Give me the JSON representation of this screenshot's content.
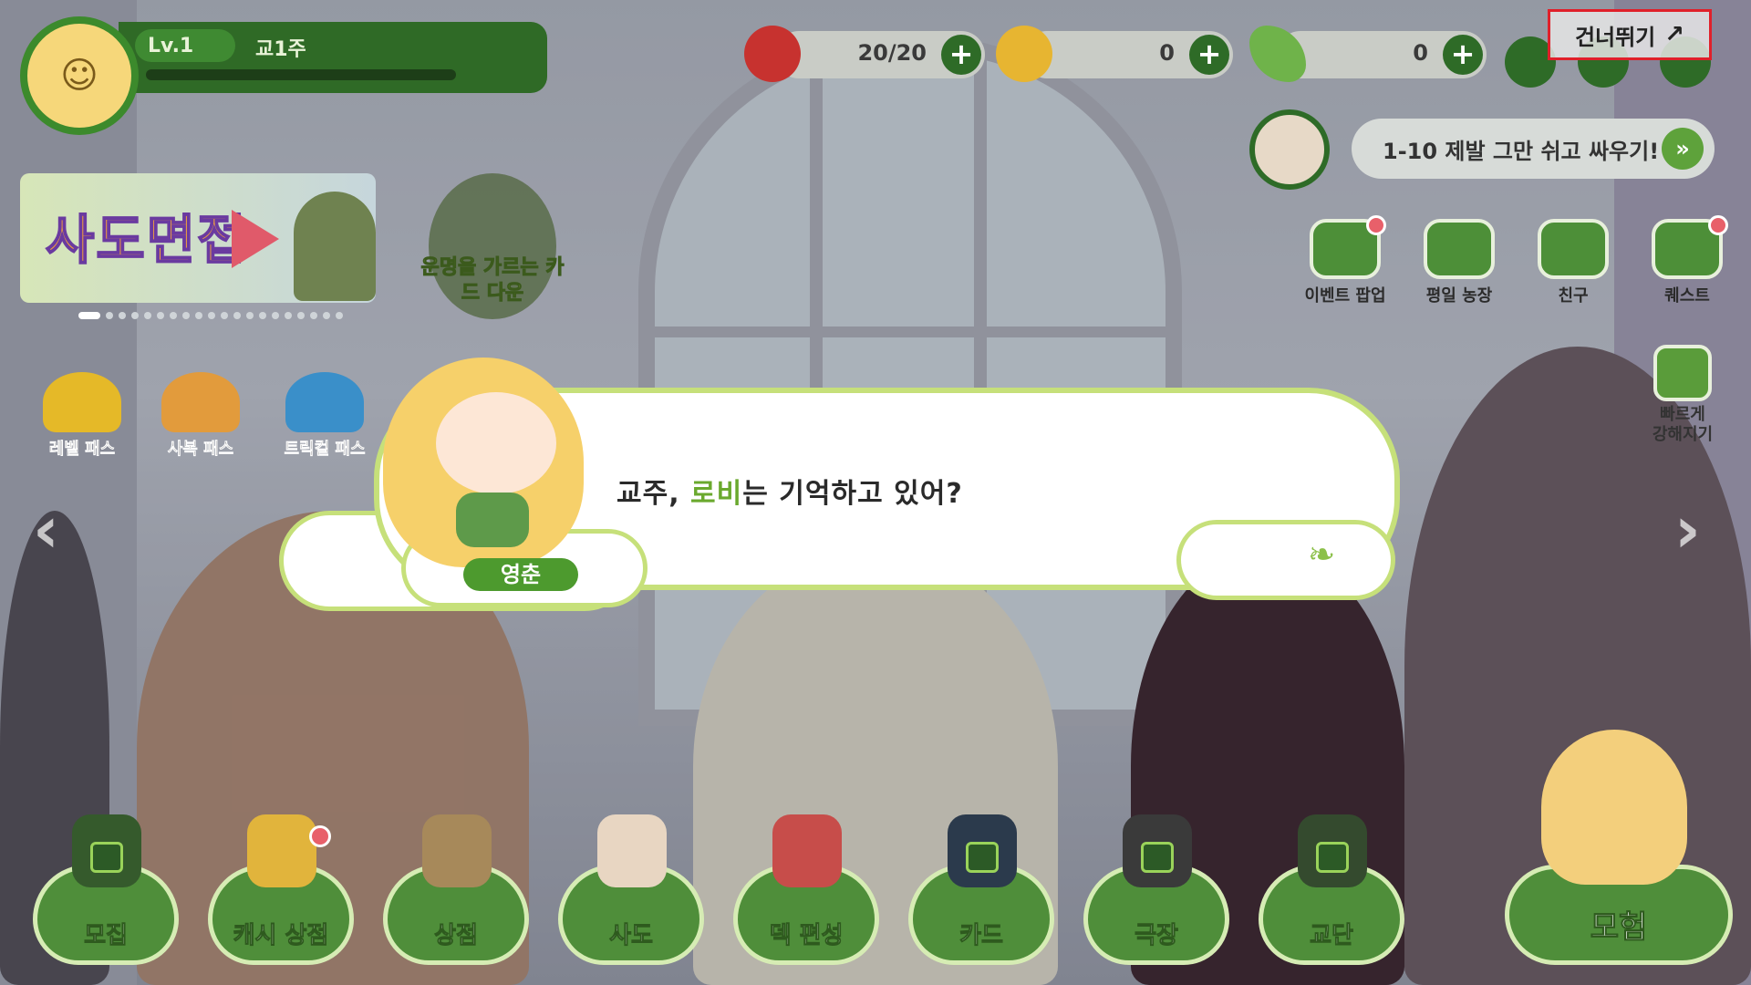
{
  "profile": {
    "level": "Lv.1",
    "name": "교1주",
    "exp_fraction": 0.0
  },
  "currencies": [
    {
      "id": "stamina",
      "value": "20/20",
      "icon": "red-orb-icon",
      "color": "#c7322f"
    },
    {
      "id": "gold",
      "value": "0",
      "icon": "gold-leaf-coin-icon",
      "color": "#e7b531"
    },
    {
      "id": "gem",
      "value": "0",
      "icon": "butterfly-gem-icon",
      "color": "#6fb34a"
    }
  ],
  "skip": {
    "label": "건너뛰기",
    "icon": "arrow-skip-icon"
  },
  "quest": {
    "text": "1-10 제발 그만 쉬고 싸우기!",
    "go_icon": "double-chevron-right-icon"
  },
  "event_banner": {
    "title": "사도면접"
  },
  "fortune_banner": {
    "text": "운명을 가르는 카드 다운"
  },
  "passes": [
    {
      "label": "레벨 패스",
      "icon": "sunflower-icon"
    },
    {
      "label": "사복 패스",
      "icon": "gift-bag-icon"
    },
    {
      "label": "트릭컬 패스",
      "icon": "ticket-icon"
    }
  ],
  "right_menu": [
    {
      "label": "이벤트 팝업",
      "icon": "leaf-card-icon",
      "badge": true
    },
    {
      "label": "평일 농장",
      "icon": "farm-icon",
      "badge": false
    },
    {
      "label": "친구",
      "icon": "friends-icon",
      "badge": false
    },
    {
      "label": "퀘스트",
      "icon": "check-board-icon",
      "badge": true
    }
  ],
  "boost": {
    "label_line1": "빠르게",
    "label_line2": "강해지기",
    "icon": "tv-sprout-icon"
  },
  "dialog": {
    "speaker": "영춘",
    "text_before": "교주, ",
    "text_highlight": "로비",
    "text_after": "는 기억하고 있어?",
    "highlight_color": "#6aa92e"
  },
  "bottom_nav": [
    {
      "label": "모집",
      "icon": "recruit-icon",
      "locked": true
    },
    {
      "label": "캐시 상점",
      "icon": "cash-shop-icon",
      "locked": false,
      "badge": true
    },
    {
      "label": "상점",
      "icon": "shop-coin-icon",
      "locked": false
    },
    {
      "label": "사도",
      "icon": "apostle-icon",
      "locked": false
    },
    {
      "label": "덱 편성",
      "icon": "crossed-swords-icon",
      "locked": false
    },
    {
      "label": "카드",
      "icon": "card-icon",
      "locked": true
    },
    {
      "label": "극장",
      "icon": "theater-icon",
      "locked": true
    },
    {
      "label": "교단",
      "icon": "order-icon",
      "locked": true
    }
  ],
  "adventure": {
    "label": "모험",
    "icon": "adventure-character-icon"
  },
  "colors": {
    "primary_green": "#4f8e3a",
    "dark_green": "#2e6b27",
    "accent_red": "#e0202a"
  }
}
